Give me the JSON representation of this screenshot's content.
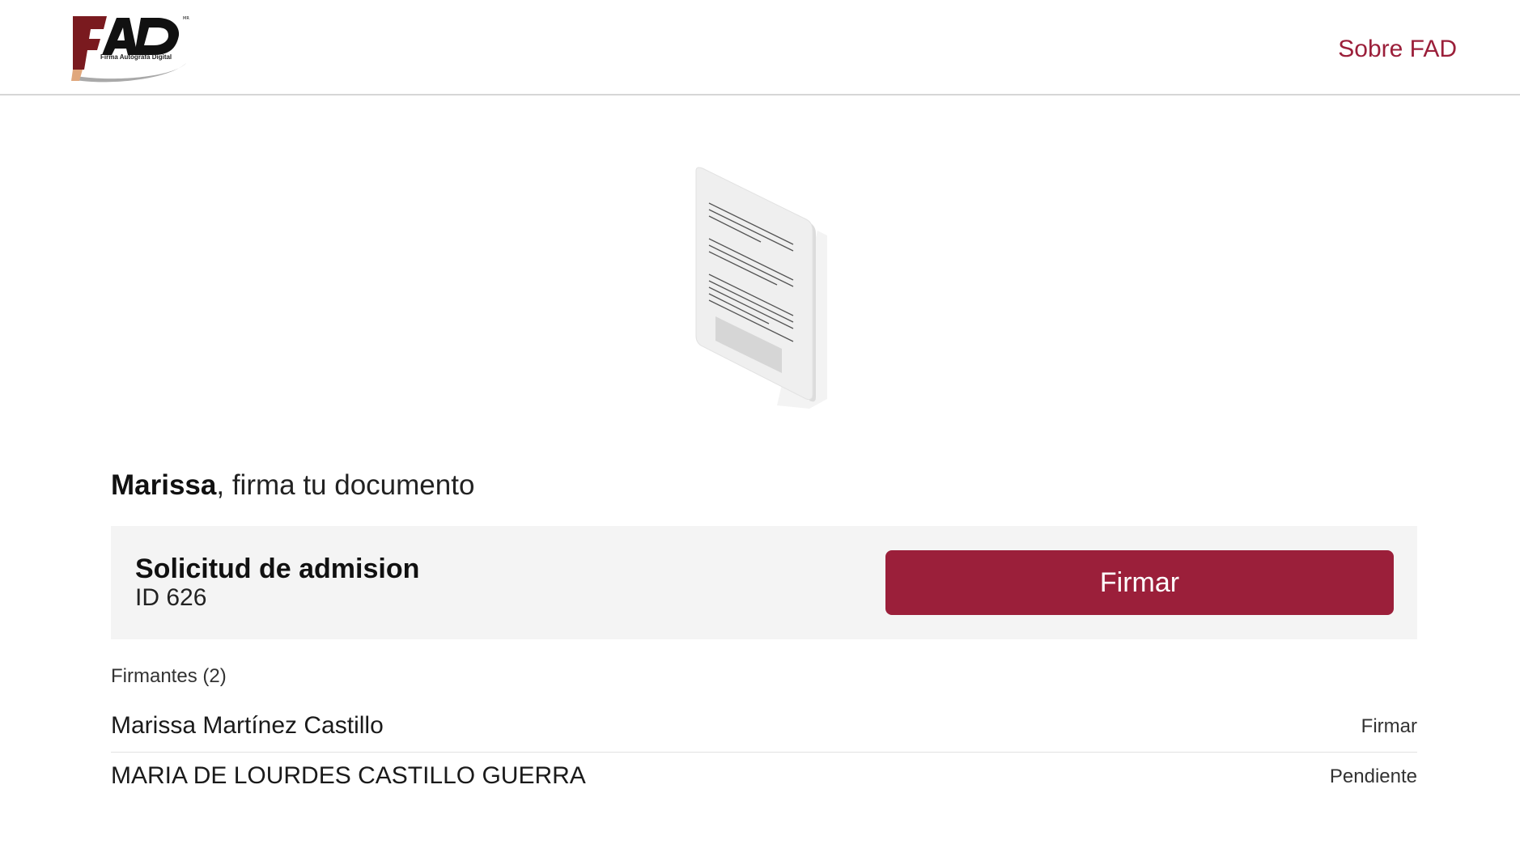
{
  "header": {
    "logo_text": "FAD",
    "logo_tagline": "Firma Autógrafa Digital",
    "nav_link": "Sobre FAD"
  },
  "illustration": {
    "icon": "document-icon"
  },
  "greeting": {
    "name": "Marissa",
    "message": ", firma tu documento"
  },
  "document": {
    "title": "Solicitud de admision",
    "id": "ID 626",
    "sign_button": "Firmar"
  },
  "signers": {
    "label": "Firmantes (2)",
    "items": [
      {
        "name": "Marissa Martínez Castillo",
        "status": "Firmar"
      },
      {
        "name": "MARIA DE LOURDES CASTILLO GUERRA",
        "status": "Pendiente"
      }
    ]
  },
  "colors": {
    "brand": "#9b1f3a",
    "logo_dark_red": "#7a1a1f",
    "card_bg": "#f4f4f4"
  }
}
